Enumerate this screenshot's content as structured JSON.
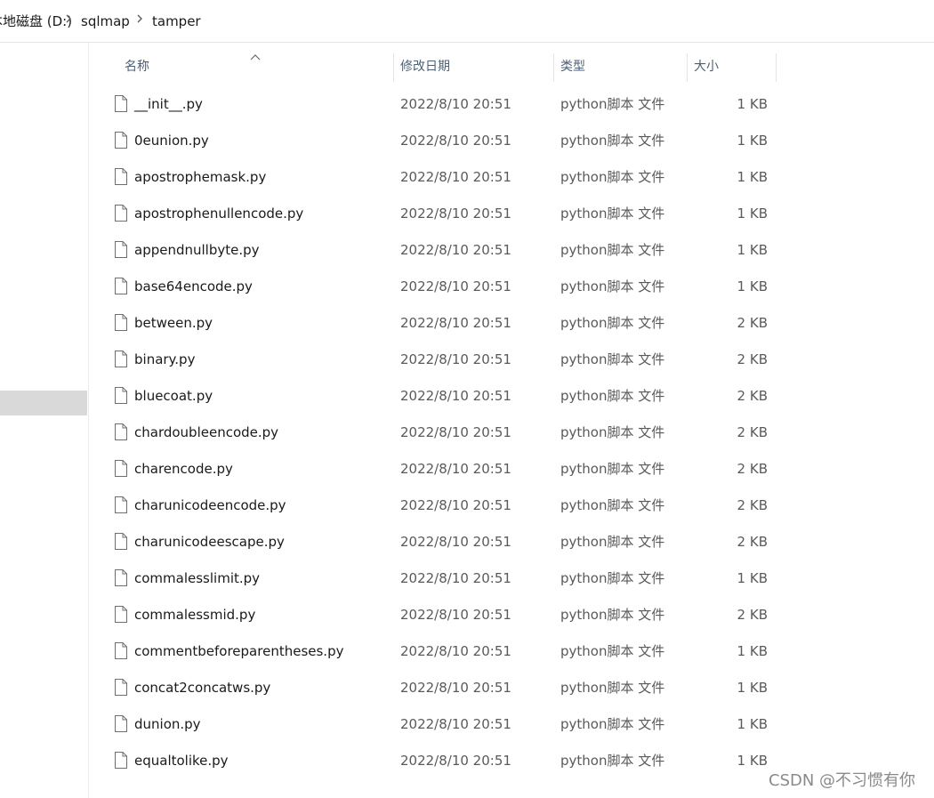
{
  "breadcrumb": [
    {
      "label": "本地磁盘 (D:)"
    },
    {
      "label": "sqlmap"
    },
    {
      "label": "tamper"
    }
  ],
  "columns": {
    "name": "名称",
    "modified": "修改日期",
    "type": "类型",
    "size": "大小"
  },
  "files": [
    {
      "name": "__init__.py",
      "modified": "2022/8/10 20:51",
      "type": "python脚本 文件",
      "size": "1 KB"
    },
    {
      "name": "0eunion.py",
      "modified": "2022/8/10 20:51",
      "type": "python脚本 文件",
      "size": "1 KB"
    },
    {
      "name": "apostrophemask.py",
      "modified": "2022/8/10 20:51",
      "type": "python脚本 文件",
      "size": "1 KB"
    },
    {
      "name": "apostrophenullencode.py",
      "modified": "2022/8/10 20:51",
      "type": "python脚本 文件",
      "size": "1 KB"
    },
    {
      "name": "appendnullbyte.py",
      "modified": "2022/8/10 20:51",
      "type": "python脚本 文件",
      "size": "1 KB"
    },
    {
      "name": "base64encode.py",
      "modified": "2022/8/10 20:51",
      "type": "python脚本 文件",
      "size": "1 KB"
    },
    {
      "name": "between.py",
      "modified": "2022/8/10 20:51",
      "type": "python脚本 文件",
      "size": "2 KB"
    },
    {
      "name": "binary.py",
      "modified": "2022/8/10 20:51",
      "type": "python脚本 文件",
      "size": "2 KB"
    },
    {
      "name": "bluecoat.py",
      "modified": "2022/8/10 20:51",
      "type": "python脚本 文件",
      "size": "2 KB"
    },
    {
      "name": "chardoubleencode.py",
      "modified": "2022/8/10 20:51",
      "type": "python脚本 文件",
      "size": "2 KB"
    },
    {
      "name": "charencode.py",
      "modified": "2022/8/10 20:51",
      "type": "python脚本 文件",
      "size": "2 KB"
    },
    {
      "name": "charunicodeencode.py",
      "modified": "2022/8/10 20:51",
      "type": "python脚本 文件",
      "size": "2 KB"
    },
    {
      "name": "charunicodeescape.py",
      "modified": "2022/8/10 20:51",
      "type": "python脚本 文件",
      "size": "2 KB"
    },
    {
      "name": "commalesslimit.py",
      "modified": "2022/8/10 20:51",
      "type": "python脚本 文件",
      "size": "1 KB"
    },
    {
      "name": "commalessmid.py",
      "modified": "2022/8/10 20:51",
      "type": "python脚本 文件",
      "size": "2 KB"
    },
    {
      "name": "commentbeforeparentheses.py",
      "modified": "2022/8/10 20:51",
      "type": "python脚本 文件",
      "size": "1 KB"
    },
    {
      "name": "concat2concatws.py",
      "modified": "2022/8/10 20:51",
      "type": "python脚本 文件",
      "size": "1 KB"
    },
    {
      "name": "dunion.py",
      "modified": "2022/8/10 20:51",
      "type": "python脚本 文件",
      "size": "1 KB"
    },
    {
      "name": "equaltolike.py",
      "modified": "2022/8/10 20:51",
      "type": "python脚本 文件",
      "size": "1 KB"
    }
  ],
  "watermark": "CSDN @不习惯有你",
  "colors": {
    "header_text": "#4c607a",
    "nav_selected": "#d9d9d9",
    "meta_text": "#5a5a5a"
  },
  "icons": {
    "file": "document-icon",
    "separator": "chevron-right-icon",
    "sort": "sort-ascending-icon"
  }
}
